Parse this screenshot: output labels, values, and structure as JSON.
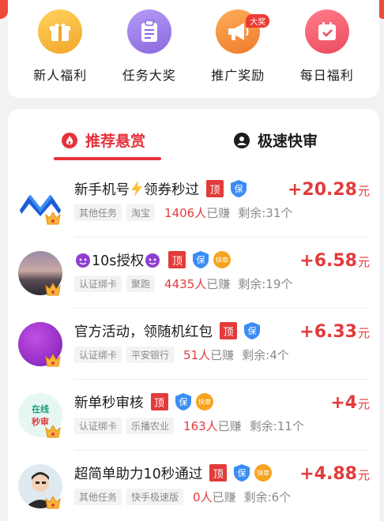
{
  "categories": [
    {
      "label": "新人福利",
      "icon": "gift-icon",
      "color": "#f5b335"
    },
    {
      "label": "任务大奖",
      "icon": "clipboard-icon",
      "color": "#9b7be8"
    },
    {
      "label": "推广奖励",
      "icon": "megaphone-icon",
      "color": "#f28a3a",
      "badge": "大奖"
    },
    {
      "label": "每日福利",
      "icon": "calendar-icon",
      "color": "#f0576b"
    }
  ],
  "tabs": {
    "recommend": "推荐悬赏",
    "fast": "极速快审"
  },
  "tags": {
    "top": "顶",
    "bao": "保",
    "kuai": "快审"
  },
  "currency": "元",
  "tasks": [
    {
      "title_pre": "新手机号",
      "title_post": "领券秒过",
      "chips": [
        "其他任务",
        "淘宝"
      ],
      "earned_count": "1406人",
      "earned_suffix": "已赚",
      "remain": "剩余:31个",
      "price": "+20.28",
      "kuai": false
    },
    {
      "title_pre": "10s授权",
      "chips": [
        "认证绑卡",
        "聚跑"
      ],
      "earned_count": "4435人",
      "earned_suffix": "已赚",
      "remain": "剩余:19个",
      "price": "+6.58",
      "kuai": true
    },
    {
      "title_pre": "官方活动，领随机红包",
      "chips": [
        "认证绑卡",
        "平安银行"
      ],
      "earned_count": "51人",
      "earned_suffix": "已赚",
      "remain": "剩余:4个",
      "price": "+6.33",
      "kuai": false
    },
    {
      "title_pre": "新单秒审核",
      "chips": [
        "认证绑卡",
        "乐播农业"
      ],
      "earned_count": "163人",
      "earned_suffix": "已赚",
      "remain": "剩余:11个",
      "price": "+4",
      "kuai": true,
      "avatar_text": [
        "在线",
        "秒审"
      ]
    },
    {
      "title_pre": "超简单助力10秒通过",
      "chips": [
        "其他任务",
        "快手极速版"
      ],
      "earned_count": "0人",
      "earned_suffix": "已赚",
      "remain": "剩余:6个",
      "price": "+4.88",
      "kuai": true
    }
  ]
}
